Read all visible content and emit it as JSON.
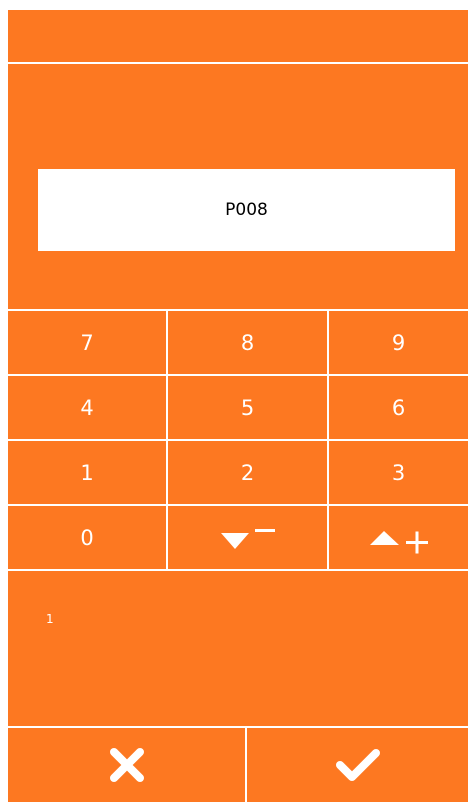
{
  "display": {
    "value": "P008"
  },
  "keypad": {
    "keys": [
      "7",
      "8",
      "9",
      "4",
      "5",
      "6",
      "1",
      "2",
      "3",
      "0"
    ],
    "decrement_icon": "down-triangle-minus-icon",
    "increment_icon": "up-triangle-plus-icon"
  },
  "info": {
    "text": "1"
  },
  "actions": {
    "cancel_icon": "x-icon",
    "confirm_icon": "checkmark-icon"
  },
  "colors": {
    "background": "#fd7821",
    "foreground": "#ffffff",
    "display_bg": "#ffffff",
    "display_text": "#000000"
  }
}
